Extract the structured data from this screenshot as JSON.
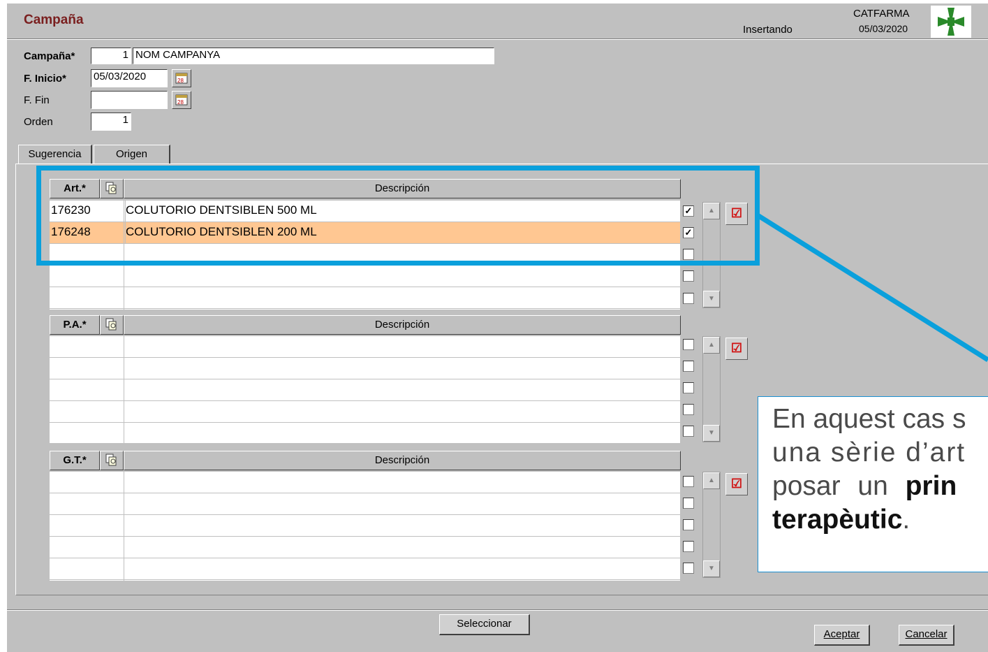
{
  "window": {
    "title": "Campaña",
    "mode": "Insertando",
    "company": "CATFARMA",
    "date": "05/03/2020",
    "logo_icon": "green-cross-icon"
  },
  "form": {
    "campaign_label": "Campaña*",
    "campaign_number": "1",
    "campaign_name": "NOM CAMPANYA",
    "start_label": "F. Inicio*",
    "start_value": "05/03/2020",
    "end_label": "F. Fin",
    "end_value": "",
    "order_label": "Orden",
    "order_value": "1"
  },
  "tabs": [
    {
      "label": "Sugerencia",
      "active": true
    },
    {
      "label": "Origen",
      "active": false
    }
  ],
  "sections": {
    "articles": {
      "code_header": "Art.*",
      "desc_header": "Descripción",
      "rows": [
        {
          "code": "176230",
          "desc": "COLUTORIO DENTSIBLEN 500 ML",
          "checked": true
        },
        {
          "code": "176248",
          "desc": "COLUTORIO DENTSIBLEN 200 ML",
          "checked": true
        },
        {
          "code": "",
          "desc": "",
          "checked": false
        },
        {
          "code": "",
          "desc": "",
          "checked": false
        },
        {
          "code": "",
          "desc": "",
          "checked": false
        }
      ]
    },
    "active_principles": {
      "code_header": "P.A.*",
      "desc_header": "Descripción",
      "rows": [
        {
          "code": "",
          "desc": "",
          "checked": false
        },
        {
          "code": "",
          "desc": "",
          "checked": false
        },
        {
          "code": "",
          "desc": "",
          "checked": false
        },
        {
          "code": "",
          "desc": "",
          "checked": false
        },
        {
          "code": "",
          "desc": "",
          "checked": false
        }
      ]
    },
    "therapeutic_groups": {
      "code_header": "G.T.*",
      "desc_header": "Descripción",
      "rows": [
        {
          "code": "",
          "desc": "",
          "checked": false
        },
        {
          "code": "",
          "desc": "",
          "checked": false
        },
        {
          "code": "",
          "desc": "",
          "checked": false
        },
        {
          "code": "",
          "desc": "",
          "checked": false
        },
        {
          "code": "",
          "desc": "",
          "checked": false
        }
      ]
    }
  },
  "buttons": {
    "select": "Seleccionar",
    "accept": "Aceptar",
    "cancel": "Cancelar"
  },
  "annotation": {
    "line1": "En aquest cas s",
    "line2": "una sèrie d’art",
    "line3_pre": "posar un ",
    "line3_bold": "prin",
    "line4_bold": "terapèutic",
    "line4_post": "."
  },
  "colors": {
    "highlight_row": "#ffc792",
    "callout": "#0aa0dc",
    "title": "#7a1f1f"
  }
}
